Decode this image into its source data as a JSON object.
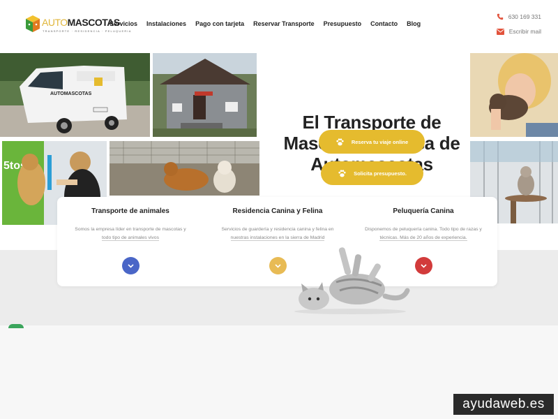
{
  "brand": {
    "logo_auto": "AUTO",
    "logo_mascotas": "MASCOTAS",
    "logo_tagline": "TRANSPORTE · RESIDENCIA · PELUQUERIA"
  },
  "nav": {
    "items": [
      "Servicios",
      "Instalaciones",
      "Pago con tarjeta",
      "Reservar Transporte",
      "Presupuesto",
      "Contacto",
      "Blog"
    ]
  },
  "contact": {
    "phone": "630 169 331",
    "email_label": "Escribir mail",
    "phone_icon": "phone-icon",
    "email_icon": "envelope-icon"
  },
  "hero": {
    "headline": "El Transporte de Mascotas es cosa de Automascotas",
    "buttons": [
      {
        "label": "Reserva tu viaje online",
        "icon": "paw-icon"
      },
      {
        "label": "Solicita presupuesto.",
        "icon": "paw-icon"
      }
    ]
  },
  "services": [
    {
      "title": "Transporte de animales",
      "text_line1": "Somos la empresa líder en transporte de mascotas y",
      "text_line2": "todo tipo de animales vivos",
      "icon": "chevron-down-icon",
      "color": "#4a66c7"
    },
    {
      "title": "Residencia Canina y Felina",
      "text_line1": "Servicios de guardería y residencia canina y felina en",
      "text_line2": "nuestras instalaciones en la sierra de Madrid",
      "icon": "chevron-down-icon",
      "color": "#e8bb55"
    },
    {
      "title": "Peluquería Canina",
      "text_line1": "Disponemos de peluquería canina. Todo tipo de razas y",
      "text_line2": "técnicas. Más de 20 años de experiencia.",
      "icon": "chevron-down-icon",
      "color": "#d23b3b"
    }
  ],
  "colors": {
    "accent": "#e5bb2e",
    "text": "#222222"
  },
  "watermark": "ayudaweb.es"
}
